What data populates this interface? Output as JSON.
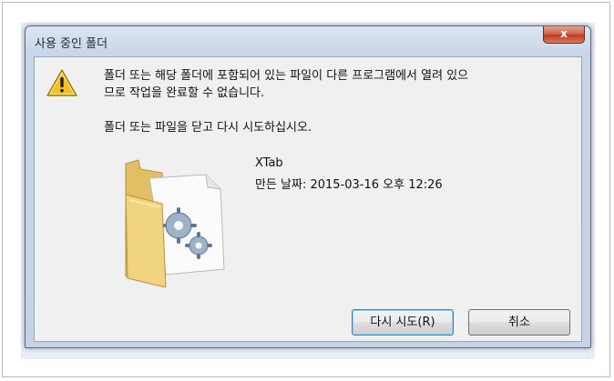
{
  "dialog": {
    "title": "사용 중인 폴더",
    "close_label": "x",
    "message_line1": "폴더 또는 해당 폴더에 포함되어 있는 파일이 다른 프로그램에서 열려 있으",
    "message_line2": "므로 작업을 완료할 수 없습니다.",
    "instruction": "폴더 또는 파일을 닫고 다시 시도하십시오.",
    "item": {
      "name": "XTab",
      "date": "만든 날짜: 2015-03-16 오후 12:26"
    },
    "buttons": {
      "retry": "다시 시도(R)",
      "cancel": "취소"
    }
  },
  "icons": {
    "warning": "warning-triangle-icon",
    "folder": "folder-settings-icon",
    "close": "close-icon"
  },
  "colors": {
    "warning_yellow": "#f4c21b",
    "close_red": "#c9452c",
    "frame_blue": "#c7d6e8"
  }
}
